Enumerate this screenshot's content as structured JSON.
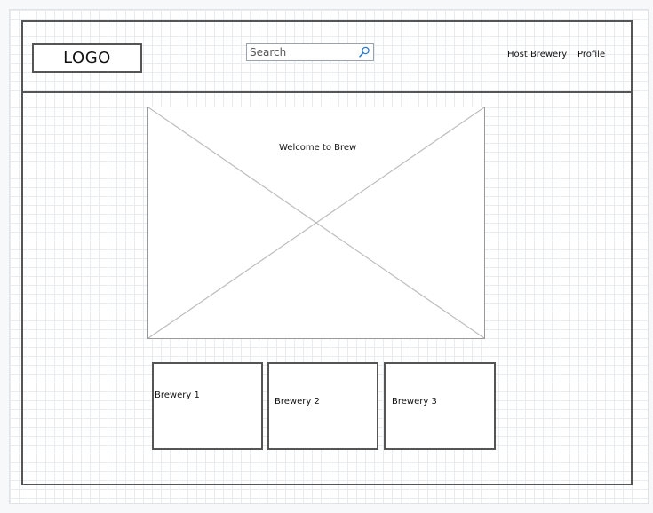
{
  "header": {
    "logo_text": "LOGO",
    "search_placeholder": "Search",
    "nav": {
      "host_brewery": "Host Brewery",
      "profile": "Profile"
    }
  },
  "hero": {
    "caption": "Welcome to Brew"
  },
  "breweries": [
    {
      "label": "Brewery 1"
    },
    {
      "label": "Brewery 2"
    },
    {
      "label": "Brewery 3"
    }
  ]
}
